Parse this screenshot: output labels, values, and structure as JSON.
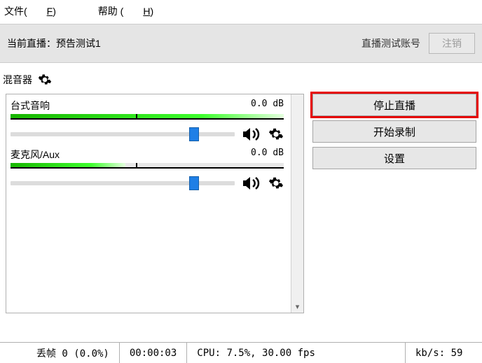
{
  "menu": {
    "file": "文件(",
    "file_u": "F",
    "file_end": ")",
    "help": "帮助 (",
    "help_u": "H",
    "help_end": ")"
  },
  "info": {
    "current_label": "当前直播：",
    "current_name": "预告测试1",
    "account": "直播测试账号",
    "logout": "注销"
  },
  "mixer_title": "混音器",
  "channels": [
    {
      "name": "台式音响",
      "level": "0.0 dB",
      "fill_pct": 100,
      "tick_pct": 46,
      "thumb_pct": 82
    },
    {
      "name": "麦克风/Aux",
      "level": "0.0 dB",
      "fill_pct": 42,
      "tick_pct": 46,
      "thumb_pct": 82
    }
  ],
  "buttons": {
    "stop_stream": "停止直播",
    "start_record": "开始录制",
    "settings": "设置"
  },
  "status": {
    "dropped": "丢帧 0 (0.0%)",
    "time": "00:00:03",
    "cpu": "CPU: 7.5%, 30.00 fps",
    "bitrate": "kb/s: 59"
  }
}
